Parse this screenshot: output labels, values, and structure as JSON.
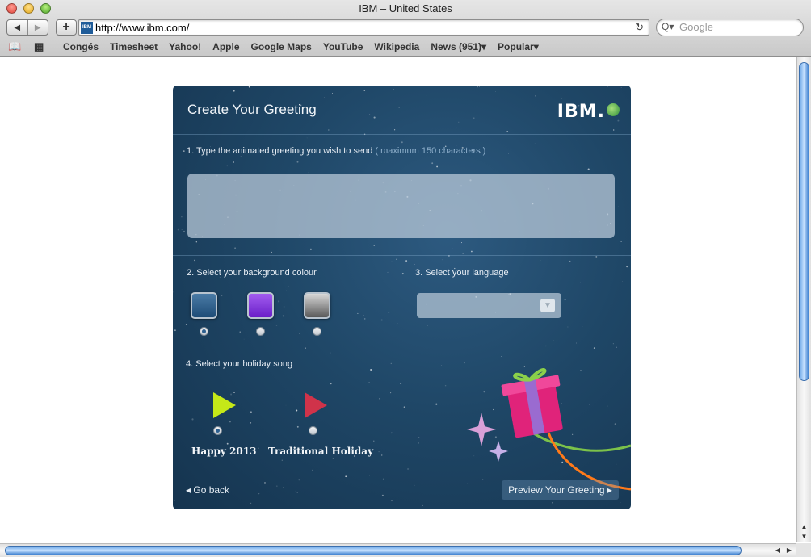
{
  "window": {
    "title": "IBM – United States"
  },
  "toolbar": {
    "back_glyph": "◀",
    "forward_glyph": "▶",
    "add_glyph": "+",
    "address": "http://www.ibm.com/",
    "reload_glyph": "↻",
    "search_placeholder": "Google",
    "search_glyph": "Q▾",
    "favicon_text": "IBM"
  },
  "bookmarks": {
    "reading_icon": "📖",
    "grid_icon": "▦",
    "items": [
      "Congés",
      "Timesheet",
      "Yahoo!",
      "Apple",
      "Google Maps",
      "YouTube",
      "Wikipedia",
      "News (951)▾",
      "Popular▾"
    ]
  },
  "card": {
    "title": "Create Your Greeting",
    "logo": "IBM.",
    "step1_label": "1. Type the animated greeting you wish to send",
    "step1_hint": "( maximum 150 characters )",
    "greeting_value": "",
    "step2_label": "2. Select your background colour",
    "step3_label": "3. Select your language",
    "language_selected": "",
    "step4_label": "4. Select your holiday song",
    "songs": [
      "Happy 2013",
      "Traditional Holiday"
    ],
    "go_back": "◂  Go back",
    "preview": "Preview Your Greeting ▸",
    "colors": {
      "blue": "#2e5f8a",
      "purple": "#8a3ae0",
      "grey": "#9a9a9a"
    }
  }
}
